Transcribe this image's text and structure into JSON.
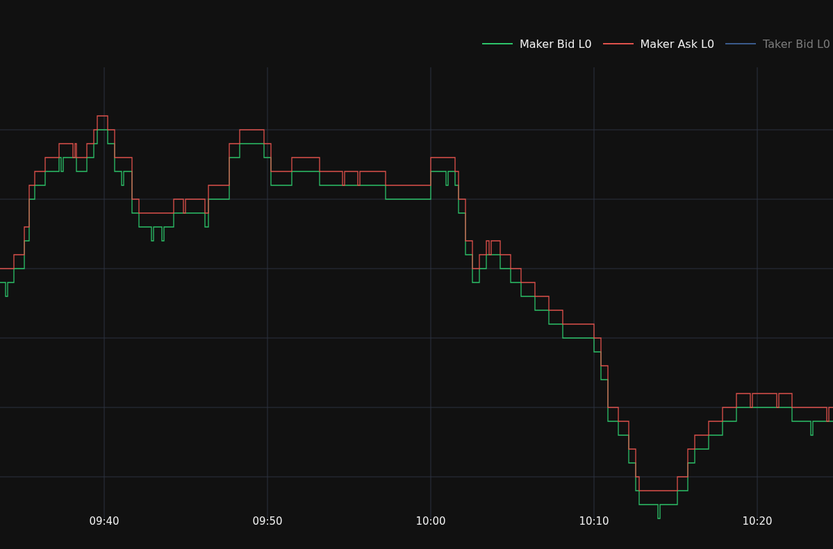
{
  "chart": {
    "legend": [
      {
        "label": "Maker Bid L0",
        "color": "#2dc46a",
        "visible": true
      },
      {
        "label": "Maker Ask L0",
        "color": "#e0524c",
        "visible": true
      },
      {
        "label": "Taker Bid L0",
        "color": "#3b5b8c",
        "visible": false
      }
    ],
    "x_ticks": [
      "09:40",
      "09:50",
      "10:00",
      "10:10",
      "10:20"
    ]
  }
}
